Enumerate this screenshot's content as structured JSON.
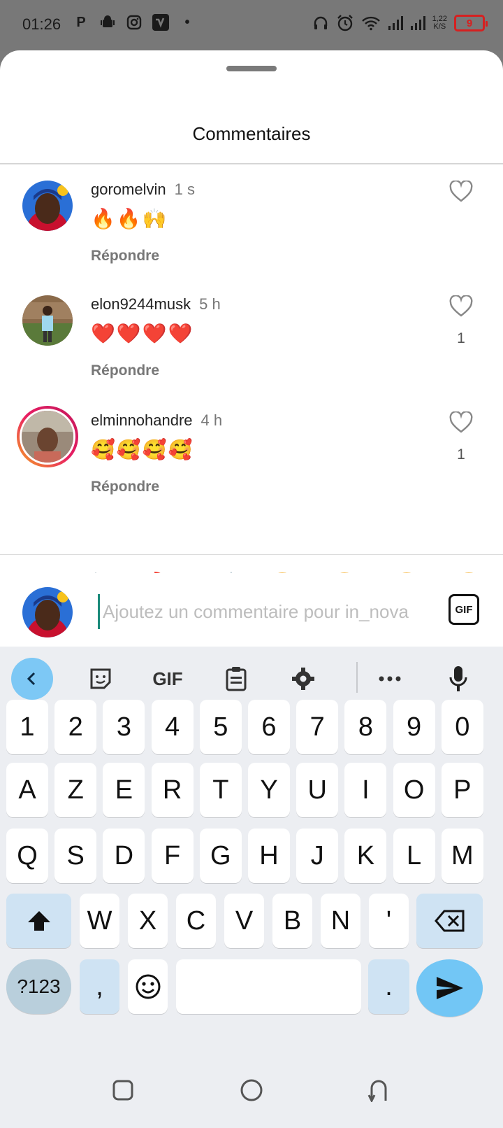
{
  "status_bar": {
    "time": "01:26",
    "speed": "1,22",
    "speed_unit": "K/S",
    "battery": "9"
  },
  "sheet": {
    "title": "Commentaires"
  },
  "comments": [
    {
      "user": "goromelvin",
      "time": "1 s",
      "text": "🔥🔥🙌",
      "reply": "Répondre",
      "likes": ""
    },
    {
      "user": "elon9244musk",
      "time": "5 h",
      "text": "❤️❤️❤️❤️",
      "reply": "Répondre",
      "likes": "1"
    },
    {
      "user": "elminnohandre",
      "time": "4 h",
      "text": "🥰🥰🥰🥰",
      "reply": "Répondre",
      "likes": "1"
    }
  ],
  "quick_emojis": [
    "❤️",
    "🙌",
    "🔥",
    "👏",
    "😢",
    "😍",
    "😮",
    "😂"
  ],
  "comment_input": {
    "placeholder": "Ajoutez un commentaire pour in_nova",
    "gif_label": "GIF"
  },
  "keyboard": {
    "toolbar_gif": "GIF",
    "row_numbers": [
      "1",
      "2",
      "3",
      "4",
      "5",
      "6",
      "7",
      "8",
      "9",
      "0"
    ],
    "row1": [
      "A",
      "Z",
      "E",
      "R",
      "T",
      "Y",
      "U",
      "I",
      "O",
      "P"
    ],
    "row2": [
      "Q",
      "S",
      "D",
      "F",
      "G",
      "H",
      "J",
      "K",
      "L",
      "M"
    ],
    "row3": [
      "W",
      "X",
      "C",
      "V",
      "B",
      "N",
      "'"
    ],
    "symbols_label": "?123",
    "comma": ",",
    "period": "."
  },
  "colors": {
    "accent": "#72c6f5",
    "ring": "#e91e63"
  }
}
